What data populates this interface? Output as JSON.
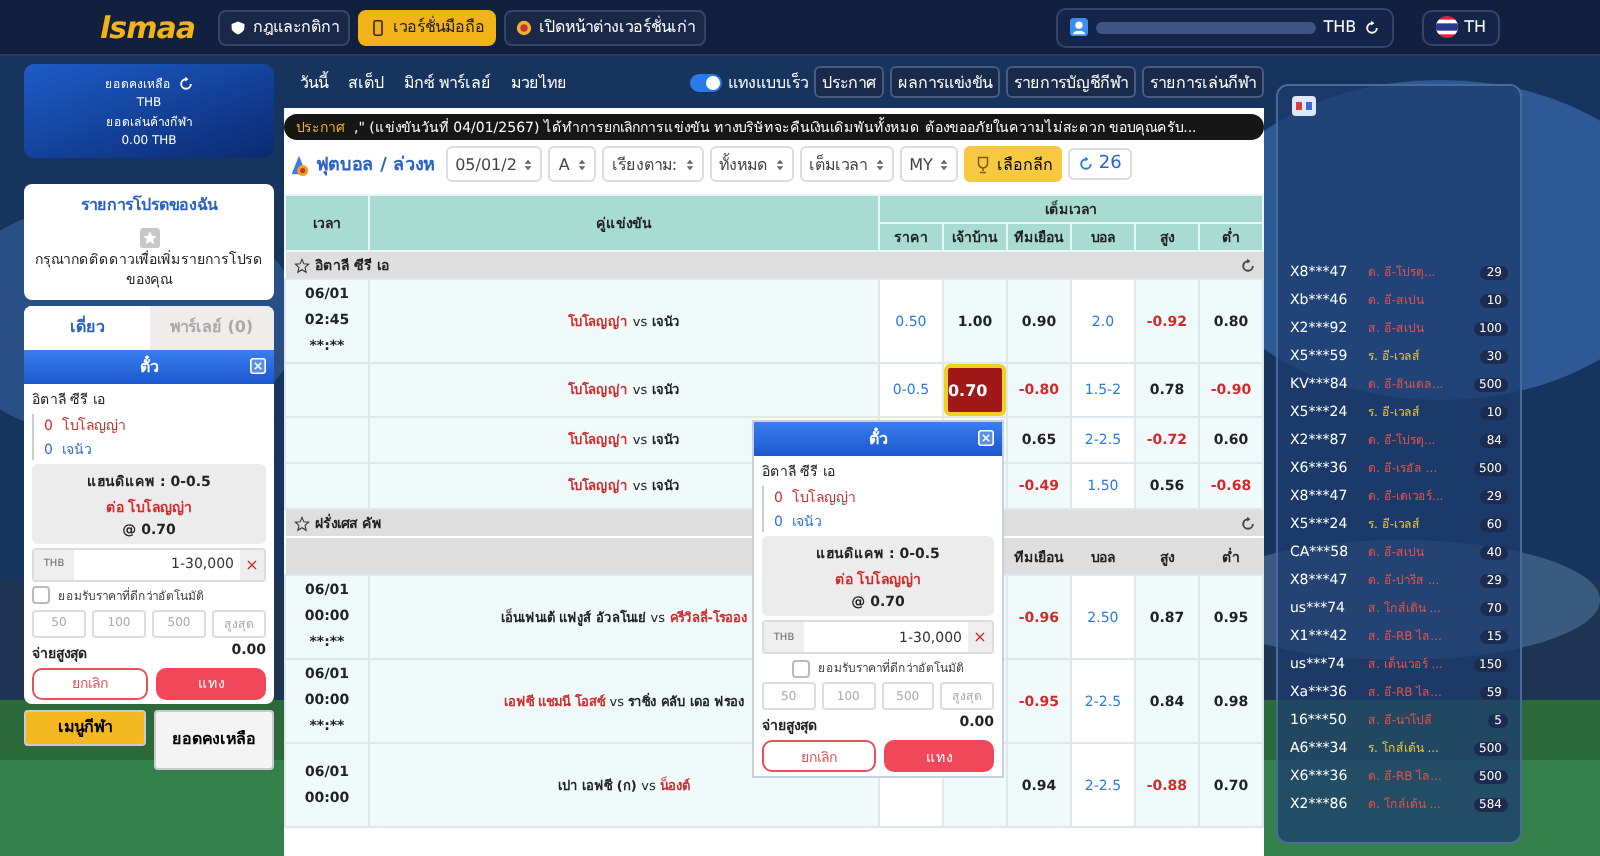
{
  "header": {
    "logo": "lsmaa",
    "buttons": [
      {
        "label": "กฎและกติกา",
        "selected": false
      },
      {
        "label": "เวอร์ชั่นมือถือ",
        "selected": true
      },
      {
        "label": "เปิดหน้าต่างเวอร์ชั่นเก่า",
        "selected": false
      }
    ],
    "currency": "THB",
    "language": "TH"
  },
  "sidebar": {
    "balance_label": "ยอดคงเหลือ",
    "balance_currency": "THB",
    "pending_label": "ยอดเล่นค้างกีฬา",
    "pending_value": "0.00 THB",
    "favorites": {
      "title": "รายการโปรดของฉัน",
      "hint": "กรุณากดติดดาวเพื่อเพิ่มรายการโปรดของคุณ"
    },
    "tabs": [
      {
        "label": "เดี่ยว",
        "selected": true
      },
      {
        "label": "พาร์เลย์ (0)",
        "selected": false
      }
    ],
    "slip": {
      "title": "ตั๋ว",
      "league": "อิตาลี ซีรี เอ",
      "home_score": "0",
      "home": "โบโลญญ่า",
      "away_score": "0",
      "away": "เจนัว",
      "handicap": "แฮนดิแคพ : 0-0.5",
      "pick": "ต่อ โบโลญญ่า",
      "odds": "@ 0.70",
      "currency": "THB",
      "placeholder": "1-30,000",
      "clear": "×",
      "auto_accept": {
        "label": "ยอมรับราคาที่ดีกว่าอัตโนมัติ",
        "checked": false
      },
      "quick": [
        "50",
        "100",
        "500",
        "สูงสุด"
      ],
      "max_label": "จ่ายสูงสุด",
      "max_value": "0.00",
      "cancel": "ยกเลิก",
      "submit": "แทง"
    },
    "bottom_buttons": [
      {
        "label": "เมนูกีฬา",
        "selected": true
      },
      {
        "label": "ยอดคงเหลือ",
        "selected": false
      }
    ]
  },
  "main": {
    "tabs": [
      {
        "label": "วันนี้",
        "selected": false
      },
      {
        "label": "สเต็ป",
        "selected": false
      },
      {
        "label": "มิกซ์ พาร์เลย์",
        "selected": false
      },
      {
        "label": "มวยไทย",
        "selected": false
      }
    ],
    "quick_bet": {
      "label": "แทงแบบเร็ว",
      "on": true
    },
    "links": [
      "ประกาศ",
      "ผลการแข่งขัน",
      "รายการบัญชีกีฬา",
      "รายการเล่นกีฬา"
    ],
    "announcement": {
      "label": "ประกาศ",
      "text": ",\" (แข่งขันวันที่ 04/01/2567) ได้ทำการยกเลิกการแข่งขัน ทางบริษัทจะคืนเงินเดิมพันทั้งหมด ต้องขออภัยในความไม่สะดวก ขอบคุณครับ..."
    },
    "breadcrumb": "ฟุตบอล / ล่วงห",
    "filters": [
      "05/01/2",
      "A",
      "เรียงตาม:",
      "ทั้งหมด",
      "เต็มเวลา",
      "MY"
    ],
    "league_button": "เลือกลีก",
    "refresh_count": "26",
    "table": {
      "time_header": "เวลา",
      "match_header": "คู่แข่งขัน",
      "group_header": "เต็มเวลา",
      "columns": [
        "ราคา",
        "เจ้าบ้าน",
        "ทีมเยือน",
        "บอล",
        "สูง",
        "ต่ำ"
      ],
      "leagues": [
        {
          "name": "อิตาลี ซีรี เอ",
          "rows": [
            {
              "time": [
                "06/01",
                "02:45",
                "**:**"
              ],
              "home": "โบโลญญ่า",
              "separator": "vs",
              "away": "เจนัว",
              "home_favorite": true,
              "away_favorite": false,
              "odds": [
                {
                  "v": "0.50",
                  "selected": false
                },
                {
                  "v": "1.00",
                  "selected": false
                },
                {
                  "v": "0.90",
                  "selected": false
                },
                {
                  "v": "2.0",
                  "selected": false
                },
                {
                  "v": "-0.92",
                  "selected": false
                },
                {
                  "v": "0.80",
                  "selected": false
                }
              ]
            },
            {
              "time": [],
              "home": "โบโลญญ่า",
              "separator": "vs",
              "away": "เจนัว",
              "home_favorite": true,
              "away_favorite": false,
              "odds": [
                {
                  "v": "0-0.5",
                  "selected": false
                },
                {
                  "v": "0.70",
                  "selected": true
                },
                {
                  "v": "-0.80",
                  "selected": false
                },
                {
                  "v": "1.5-2",
                  "selected": false
                },
                {
                  "v": "0.78",
                  "selected": false
                },
                {
                  "v": "-0.90",
                  "selected": false
                }
              ]
            },
            {
              "time": [],
              "home": "โบโลญญ่า",
              "separator": "vs",
              "away": "เจนัว",
              "home_favorite": true,
              "away_favorite": false,
              "odds": [
                {
                  "v": "0.65",
                  "selected": false
                },
                {
                  "v": "2-2.5",
                  "selected": false
                },
                {
                  "v": "-0.72",
                  "selected": false
                },
                {
                  "v": "0.60",
                  "selected": false
                }
              ]
            },
            {
              "time": [],
              "home": "โบโลญญ่า",
              "separator": "vs",
              "away": "เจนัว",
              "home_favorite": true,
              "away_favorite": false,
              "odds": [
                {
                  "v": "-0.49",
                  "selected": false
                },
                {
                  "v": "1.50",
                  "selected": false
                },
                {
                  "v": "0.56",
                  "selected": false
                },
                {
                  "v": "-0.68",
                  "selected": false
                }
              ]
            }
          ]
        },
        {
          "name": "ฝรั่งเศส คัพ",
          "column_labels": [
            "ทีมเยือน",
            "บอล",
            "สูง",
            "ต่ำ"
          ],
          "rows": [
            {
              "time": [
                "06/01",
                "00:00",
                "**:**"
              ],
              "home": "เอ็นเฟนเต้ แฟงูส์ อัวลโนเย่",
              "separator": "vs",
              "away": "ครีวิลลี่-โรออง",
              "home_favorite": false,
              "away_favorite": true,
              "odds": [
                {
                  "v": "-0.96",
                  "selected": false
                },
                {
                  "v": "2.50",
                  "selected": false
                },
                {
                  "v": "0.87",
                  "selected": false
                },
                {
                  "v": "0.95",
                  "selected": false
                }
              ]
            },
            {
              "time": [
                "06/01",
                "00:00",
                "**:**"
              ],
              "home": "เอฟซี แชมนี โอสซ์",
              "separator": "vs",
              "away": "ราซิ่ง คลับ เดอ ฟรอง",
              "home_favorite": true,
              "away_favorite": false,
              "odds": [
                {
                  "v": "-0.95",
                  "selected": false
                },
                {
                  "v": "2-2.5",
                  "selected": false
                },
                {
                  "v": "0.84",
                  "selected": false
                },
                {
                  "v": "0.98",
                  "selected": false
                }
              ]
            },
            {
              "time": [
                "06/01",
                "00:00"
              ],
              "home": "เปา เอฟซี (ก)",
              "separator": "vs",
              "away": "น็องต์",
              "home_favorite": false,
              "away_favorite": true,
              "odds": [
                {
                  "v": "0.94",
                  "selected": false
                },
                {
                  "v": "2-2.5",
                  "selected": false
                },
                {
                  "v": "-0.88",
                  "selected": false
                },
                {
                  "v": "0.70",
                  "selected": false
                }
              ]
            }
          ]
        }
      ]
    }
  },
  "popup_slip": {
    "title": "ตั๋ว",
    "league": "อิตาลี ซีรี เอ",
    "home_score": "0",
    "home": "โบโลญญ่า",
    "away_score": "0",
    "away": "เจนัว",
    "handicap": "แฮนดิแคพ : 0-0.5",
    "pick": "ต่อ โบโลญญ่า",
    "odds": "@ 0.70",
    "currency": "THB",
    "placeholder": "1-30,000",
    "clear": "×",
    "auto_accept": {
      "label": "ยอมรับราคาที่ดีกว่าอัตโนมัติ",
      "checked": false
    },
    "quick": [
      "50",
      "100",
      "500",
      "สูงสุด"
    ],
    "max_label": "จ่ายสูงสุด",
    "max_value": "0.00",
    "cancel": "ยกเลิก",
    "submit": "แทง"
  },
  "live_bets": [
    {
      "user": "X8***47",
      "bet": "ด. อี-โปรตุ...",
      "amount": "29",
      "color": "#e8504a"
    },
    {
      "user": "Xb***46",
      "bet": "ด. อี-สเปน",
      "amount": "10",
      "color": "#e8504a"
    },
    {
      "user": "X2***92",
      "bet": "ส. อี-สเปน",
      "amount": "100",
      "color": "#e8504a"
    },
    {
      "user": "X5***59",
      "bet": "ร. อี-เวลส์",
      "amount": "30",
      "color": "#e8c83a"
    },
    {
      "user": "KV***84",
      "bet": "ด. อี-อินเดล...",
      "amount": "500",
      "color": "#e8504a"
    },
    {
      "user": "X5***24",
      "bet": "ร. อี-เวลส์",
      "amount": "10",
      "color": "#e8c83a"
    },
    {
      "user": "X2***87",
      "bet": "ด. อี-โปรตุ...",
      "amount": "84",
      "color": "#e8504a"
    },
    {
      "user": "X6***36",
      "bet": "ด. อี-เรอัล ...",
      "amount": "500",
      "color": "#e8504a"
    },
    {
      "user": "X8***47",
      "bet": "ด. อี-เดเวอร์...",
      "amount": "29",
      "color": "#e8504a"
    },
    {
      "user": "X5***24",
      "bet": "ร. อี-เวลส์",
      "amount": "60",
      "color": "#e8c83a"
    },
    {
      "user": "CA***58",
      "bet": "ด. อี-สเปน",
      "amount": "40",
      "color": "#e8504a"
    },
    {
      "user": "X8***47",
      "bet": "ด. อี-ปารีส ...",
      "amount": "29",
      "color": "#e8504a"
    },
    {
      "user": "us***74",
      "bet": "ส. โกส์เดิน ...",
      "amount": "70",
      "color": "#e8504a"
    },
    {
      "user": "X1***42",
      "bet": "ส. อี-RB ไล...",
      "amount": "15",
      "color": "#e8504a"
    },
    {
      "user": "us***74",
      "bet": "ส. เด็นเวอร์ ...",
      "amount": "150",
      "color": "#e8504a"
    },
    {
      "user": "Xa***36",
      "bet": "ส. อี-RB ไล...",
      "amount": "59",
      "color": "#e8504a"
    },
    {
      "user": "16***50",
      "bet": "ส. อี-นาโปลี",
      "amount": "5",
      "color": "#e8504a"
    },
    {
      "user": "A6***34",
      "bet": "ร. โกส์เด้น ...",
      "amount": "500",
      "color": "#e8c83a"
    },
    {
      "user": "X6***36",
      "bet": "ด. อี-RB ไล...",
      "amount": "500",
      "color": "#e8504a"
    },
    {
      "user": "X2***86",
      "bet": "ด. โกล์เด้น ...",
      "amount": "584",
      "color": "#e8504a"
    }
  ]
}
